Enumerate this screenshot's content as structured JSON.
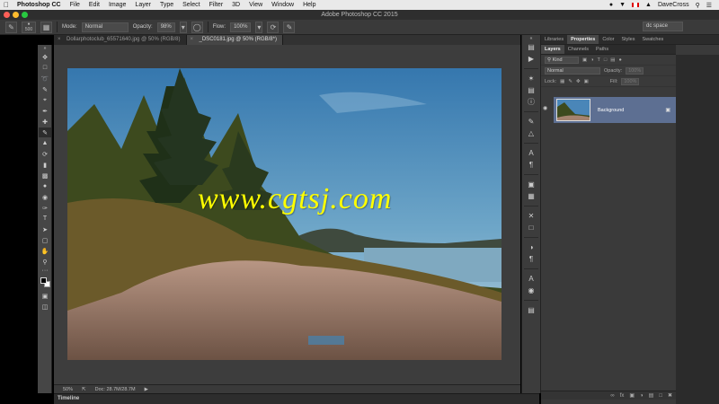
{
  "menubar": {
    "apple": "",
    "app_name": "Photoshop CC",
    "items": [
      "File",
      "Edit",
      "Image",
      "Layer",
      "Type",
      "Select",
      "Filter",
      "3D",
      "View",
      "Window",
      "Help"
    ],
    "user": "DaveCross"
  },
  "window": {
    "title": "Adobe Photoshop CC 2015"
  },
  "options": {
    "brush_size": "500",
    "mode_label": "Mode:",
    "mode_value": "Normal",
    "opacity_label": "Opacity:",
    "opacity_value": "98%",
    "flow_label": "Flow:",
    "flow_value": "100%",
    "workspace": "dc space"
  },
  "tabs": [
    {
      "label": "Dollarphotoclub_65571640.jpg @ 50% (RGB/8)"
    },
    {
      "label": "_DSC0181.jpg @ 50% (RGB/8*)"
    }
  ],
  "canvas": {
    "watermark": "www.cgtsj.com"
  },
  "status": {
    "zoom": "50%",
    "doc": "Doc: 28.7M/28.7M"
  },
  "timeline": {
    "label": "Timeline"
  },
  "panels": {
    "top_tabs": [
      "Libraries",
      "Properties",
      "Color",
      "Styles",
      "Swatches"
    ],
    "layer_tabs": [
      "Layers",
      "Channels",
      "Paths"
    ],
    "kind_label": "Kind",
    "blend_mode": "Normal",
    "opacity_label": "Opacity:",
    "opacity_value": "100%",
    "lock_label": "Lock:",
    "fill_label": "Fill:",
    "fill_value": "100%",
    "layer_name": "Background"
  },
  "colors": {
    "watermark": "#ffff00",
    "selected_layer": "#5d6f92",
    "ui_bg": "#3a3a3a"
  }
}
